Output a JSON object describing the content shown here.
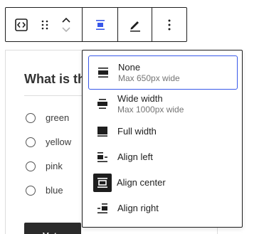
{
  "toolbar": {
    "buttons": [
      {
        "icon": "block-type-icon"
      },
      {
        "icon": "drag-handle-icon"
      },
      {
        "icon": "move-up-icon"
      },
      {
        "icon": "move-down-icon"
      },
      {
        "icon": "align-icon"
      },
      {
        "icon": "pencil-icon"
      },
      {
        "icon": "more-options-icon"
      }
    ],
    "accent_color": "#3858e9"
  },
  "poll": {
    "question": "What is the",
    "options": [
      "green",
      "yellow",
      "pink",
      "blue"
    ],
    "vote_label": "Vote"
  },
  "align_menu": {
    "items": [
      {
        "label": "None",
        "sub": "Max 650px wide",
        "icon": "align-none-icon",
        "selected": true
      },
      {
        "label": "Wide width",
        "sub": "Max 1000px wide",
        "icon": "align-wide-icon",
        "selected": false
      },
      {
        "label": "Full width",
        "sub": "",
        "icon": "align-full-icon",
        "selected": false
      },
      {
        "label": "Align left",
        "sub": "",
        "icon": "align-left-icon",
        "selected": false
      },
      {
        "label": "Align center",
        "sub": "",
        "icon": "align-center-icon",
        "selected": false
      },
      {
        "label": "Align right",
        "sub": "",
        "icon": "align-right-icon",
        "selected": false
      }
    ],
    "selected_border_color": "#3858e9"
  }
}
